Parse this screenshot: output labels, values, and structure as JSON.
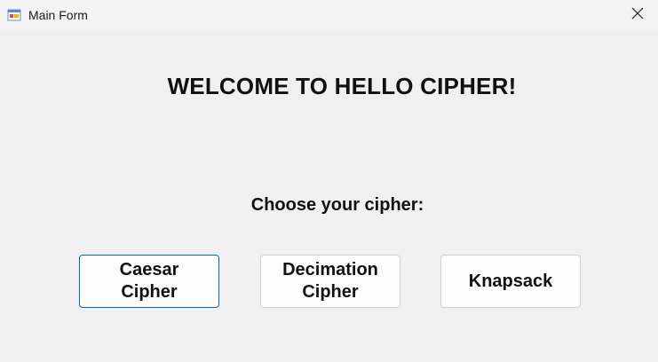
{
  "window": {
    "title": "Main Form",
    "app_icon": "windows-form-icon",
    "close_icon": "close-icon"
  },
  "main": {
    "heading": "WELCOME TO HELLO CIPHER!",
    "prompt": "Choose your cipher:",
    "buttons": [
      {
        "label": "Caesar\nCipher",
        "focused": true
      },
      {
        "label": "Decimation\nCipher",
        "focused": false
      },
      {
        "label": "Knapsack",
        "focused": false
      }
    ]
  },
  "colors": {
    "background": "#f0f0f0",
    "focus_border": "#0067c0",
    "button_bg": "#fdfdfd"
  }
}
